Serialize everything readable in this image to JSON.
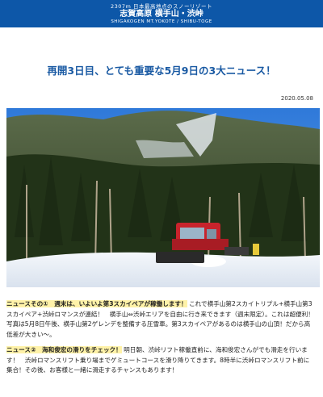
{
  "header": {
    "tagline": "2307m 日本最高地点のスノーリゾート",
    "resort_name": "志賀高原 横手山・渋峠",
    "resort_roman": "SHIGAKOGEN MT.YOKOTE / SHIBU-TOGE"
  },
  "article": {
    "title": "再開3日目、とても重要な5月9日の3大ニュース！",
    "date": "2020.05.08",
    "photo_icon": "snowcat-on-snowfield-photo",
    "news1": {
      "lead": "ニュースその①　週末は、いよいよ第3スカイペアが稼働します！",
      "body": "これで横手山第2スカイトリプル+横手山第3スカイペア+渋峠ロマンスが連結！　横手山⇔渋峠エリアを自由に行き来できます（週末限定）。これは超便利！　写真は5月8日午後、横手山第2ゲレンデを整備する圧雪車。第3スカイペアがあるのは横手山の山頂！だから高低差が大きい〜。"
    },
    "news2": {
      "lead": "ニュース②　海和俊宏の滑りをチェック！",
      "body": "明日朝、渋峠リフト稼働直前に、海和俊宏さんがでも滑走を行います！　渋峠ロマンスリフト乗り場までゲミュートコースを滑り降りてきます。8時半に渋峠ロマンスリフト前に集合！その後、お客様と一緒に滑走するチャンスもあります！"
    }
  }
}
